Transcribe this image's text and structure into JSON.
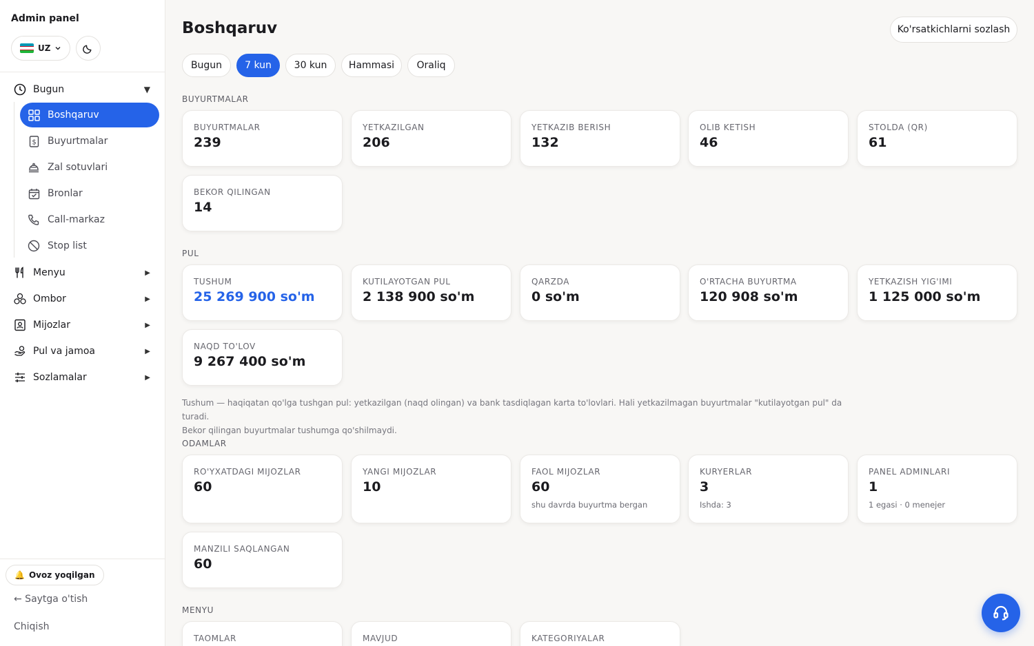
{
  "sidebar": {
    "brand": "Admin panel",
    "lang": "UZ",
    "flag_colors": [
      "#1eb53a",
      "#ffffff",
      "#0099b5"
    ],
    "groups": {
      "today": "Bugun",
      "menu": "Menyu",
      "warehouse": "Ombor",
      "customers": "Mijozlar",
      "money": "Pul va jamoa",
      "settings": "Sozlamalar"
    },
    "items": {
      "dashboard": "Boshqaruv",
      "orders": "Buyurtmalar",
      "hall": "Zal sotuvlari",
      "bookings": "Bronlar",
      "callcenter": "Call-markaz",
      "stoplist": "Stop list"
    },
    "sound": "Ovoz yoqilgan",
    "sound_icon": "🔔",
    "site_link": "← Saytga o'tish",
    "logout": "Chiqish"
  },
  "header": {
    "title": "Boshqaruv",
    "settings_button": "Ko'rsatkichlarni sozlash"
  },
  "periods": [
    "Bugun",
    "7 kun",
    "30 kun",
    "Hammasi",
    "Oraliq"
  ],
  "active_period": "7 kun",
  "sections": {
    "orders": {
      "label": "BUYURTMALAR",
      "cards": [
        {
          "label": "BUYURTMALAR",
          "value": "239"
        },
        {
          "label": "YETKAZILGAN",
          "value": "206"
        },
        {
          "label": "YETKAZIB BERISH",
          "value": "132"
        },
        {
          "label": "OLIB KETISH",
          "value": "46"
        },
        {
          "label": "STOLDA (QR)",
          "value": "61"
        },
        {
          "label": "BEKOR QILINGAN",
          "value": "14"
        }
      ]
    },
    "money": {
      "label": "PUL",
      "cards": [
        {
          "label": "TUSHUM",
          "value": "25 269 900 so'm"
        },
        {
          "label": "KUTILAYOTGAN PUL",
          "value": "2 138 900 so'm"
        },
        {
          "label": "QARZDA",
          "value": "0 so'm"
        },
        {
          "label": "O'RTACHA BUYURTMA",
          "value": "120 908 so'm"
        },
        {
          "label": "YETKAZISH YIG'IMI",
          "value": "1 125 000 so'm"
        },
        {
          "label": "NAQD TO'LOV",
          "value": "9 267 400 so'm"
        }
      ],
      "note_line1": "Tushum — haqiqatan qo'lga tushgan pul: yetkazilgan (naqd olingan) va bank tasdiqlagan karta to'lovlari. Hali yetkazilmagan buyurtmalar \"kutilayotgan pul\" da turadi.",
      "note_line2": "Bekor qilingan buyurtmalar tushumga qo'shilmaydi."
    },
    "people": {
      "label": "ODAMLAR",
      "cards": [
        {
          "label": "RO'YXATDAGI MIJOZLAR",
          "value": "60"
        },
        {
          "label": "YANGI MIJOZLAR",
          "value": "10"
        },
        {
          "label": "FAOL MIJOZLAR",
          "value": "60",
          "sub": "shu davrda buyurtma bergan"
        },
        {
          "label": "KURYERLAR",
          "value": "3",
          "sub": "Ishda: 3"
        },
        {
          "label": "PANEL ADMINLARI",
          "value": "1",
          "sub": "1 egasi · 0 menejer"
        },
        {
          "label": "MANZILI SAQLANGAN",
          "value": "60"
        }
      ]
    },
    "menu": {
      "label": "MENYU",
      "cards": [
        {
          "label": "TAOMLAR"
        },
        {
          "label": "MAVJUD"
        },
        {
          "label": "KATEGORIYALAR"
        }
      ]
    }
  },
  "colors": {
    "accent": "#2563e8",
    "background": "#f8f7f5"
  }
}
